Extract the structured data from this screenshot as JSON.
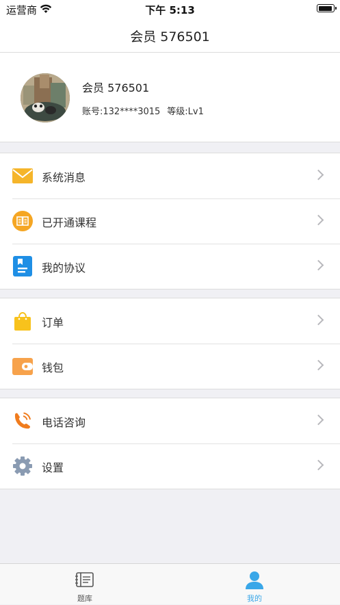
{
  "status_bar": {
    "carrier": "运营商",
    "time": "下午 5:13"
  },
  "nav": {
    "title": "会员 576501"
  },
  "profile": {
    "name": "会员 576501",
    "account": "账号:132****3015",
    "level": "等级:Lv1"
  },
  "menu_groups": [
    {
      "items": [
        {
          "label": "系统消息",
          "icon": "envelope-icon"
        },
        {
          "label": "已开通课程",
          "icon": "book-icon"
        },
        {
          "label": "我的协议",
          "icon": "document-icon"
        }
      ]
    },
    {
      "items": [
        {
          "label": "订单",
          "icon": "shopping-bag-icon"
        },
        {
          "label": "钱包",
          "icon": "wallet-icon"
        }
      ]
    },
    {
      "items": [
        {
          "label": "电话咨询",
          "icon": "phone-icon"
        },
        {
          "label": "设置",
          "icon": "gear-icon"
        }
      ]
    }
  ],
  "tabs": [
    {
      "label": "题库",
      "icon": "question-bank-icon",
      "active": false
    },
    {
      "label": "我的",
      "icon": "person-icon",
      "active": true
    }
  ],
  "colors": {
    "active_tab": "#3aa7e8",
    "inactive_tab": "#555555",
    "envelope": "#f5b52a",
    "book": "#f5a623",
    "document": "#1f8fe5",
    "bag": "#f8c21c",
    "wallet": "#f7a24b",
    "phone": "#f07c1e",
    "gear": "#8a9bb2"
  }
}
